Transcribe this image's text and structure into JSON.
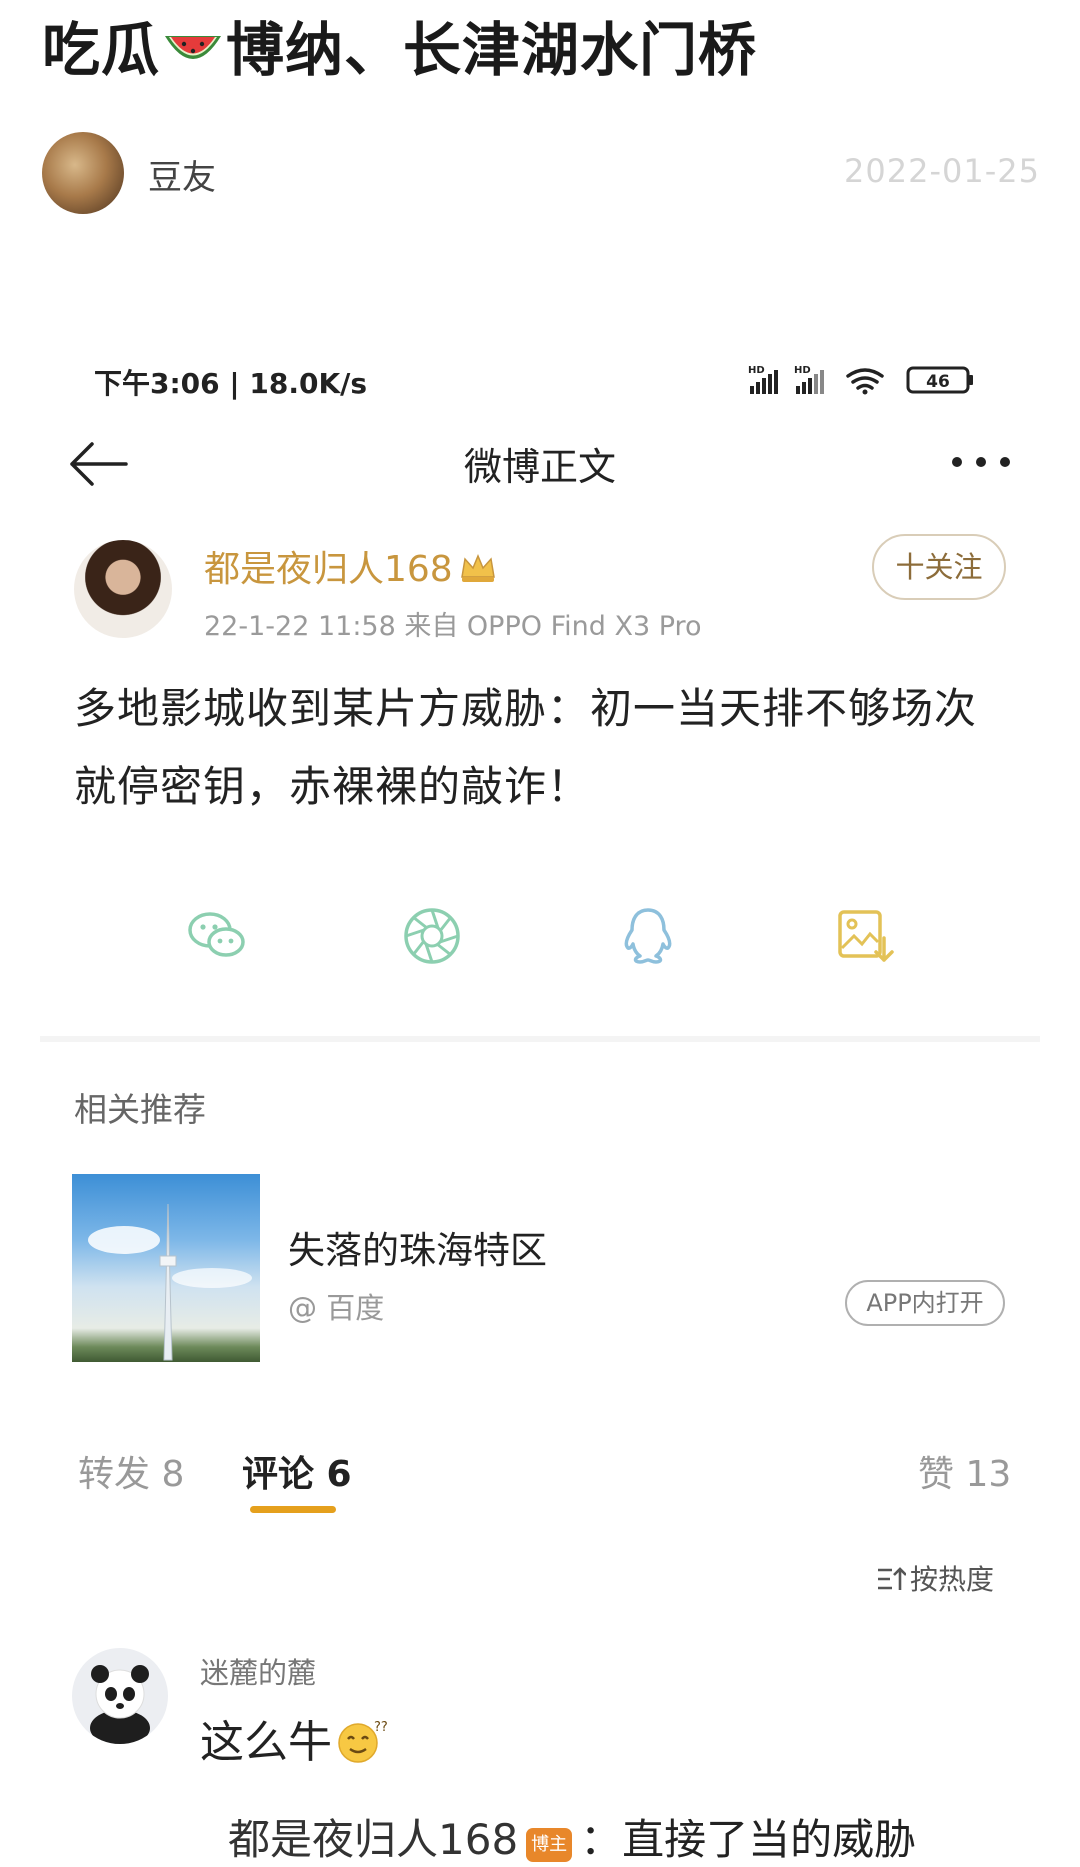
{
  "post": {
    "title_before": "吃瓜",
    "title_after": "博纳、长津湖水门桥",
    "author": "豆友",
    "date": "2022-01-25"
  },
  "status_bar": {
    "time_speed": "下午3:06 | 18.0K/s",
    "battery": "46"
  },
  "nav": {
    "title": "微博正文"
  },
  "weibo": {
    "user_name": "都是夜归人168",
    "meta": "22-1-22 11:58 来自 OPPO Find X3 Pro",
    "follow_label": "十关注",
    "text": "多地影城收到某片方威胁：初一当天排不够场次就停密钥，赤裸裸的敲诈！"
  },
  "share_icons": [
    "wechat-icon",
    "moments-icon",
    "qq-icon",
    "save-image-icon"
  ],
  "recommend": {
    "section_title": "相关推荐",
    "headline": "失落的珠海特区",
    "source": "@ 百度",
    "open_label": "APP内打开"
  },
  "tabs": {
    "repost": "转发 8",
    "comment": "评论 6",
    "like": "赞 13"
  },
  "sort_label": "按热度",
  "comment": {
    "user": "迷麓的麓",
    "text": "这么牛",
    "reply_name": "都是夜归人168",
    "reply_badge": "博主",
    "reply_text": "：直接了当的威胁"
  },
  "colors": {
    "accent": "#e5a01d",
    "username": "#c8963e",
    "share_green": "#8ccfb0",
    "share_blue": "#8ec0dc",
    "share_yellow": "#e3c257"
  }
}
